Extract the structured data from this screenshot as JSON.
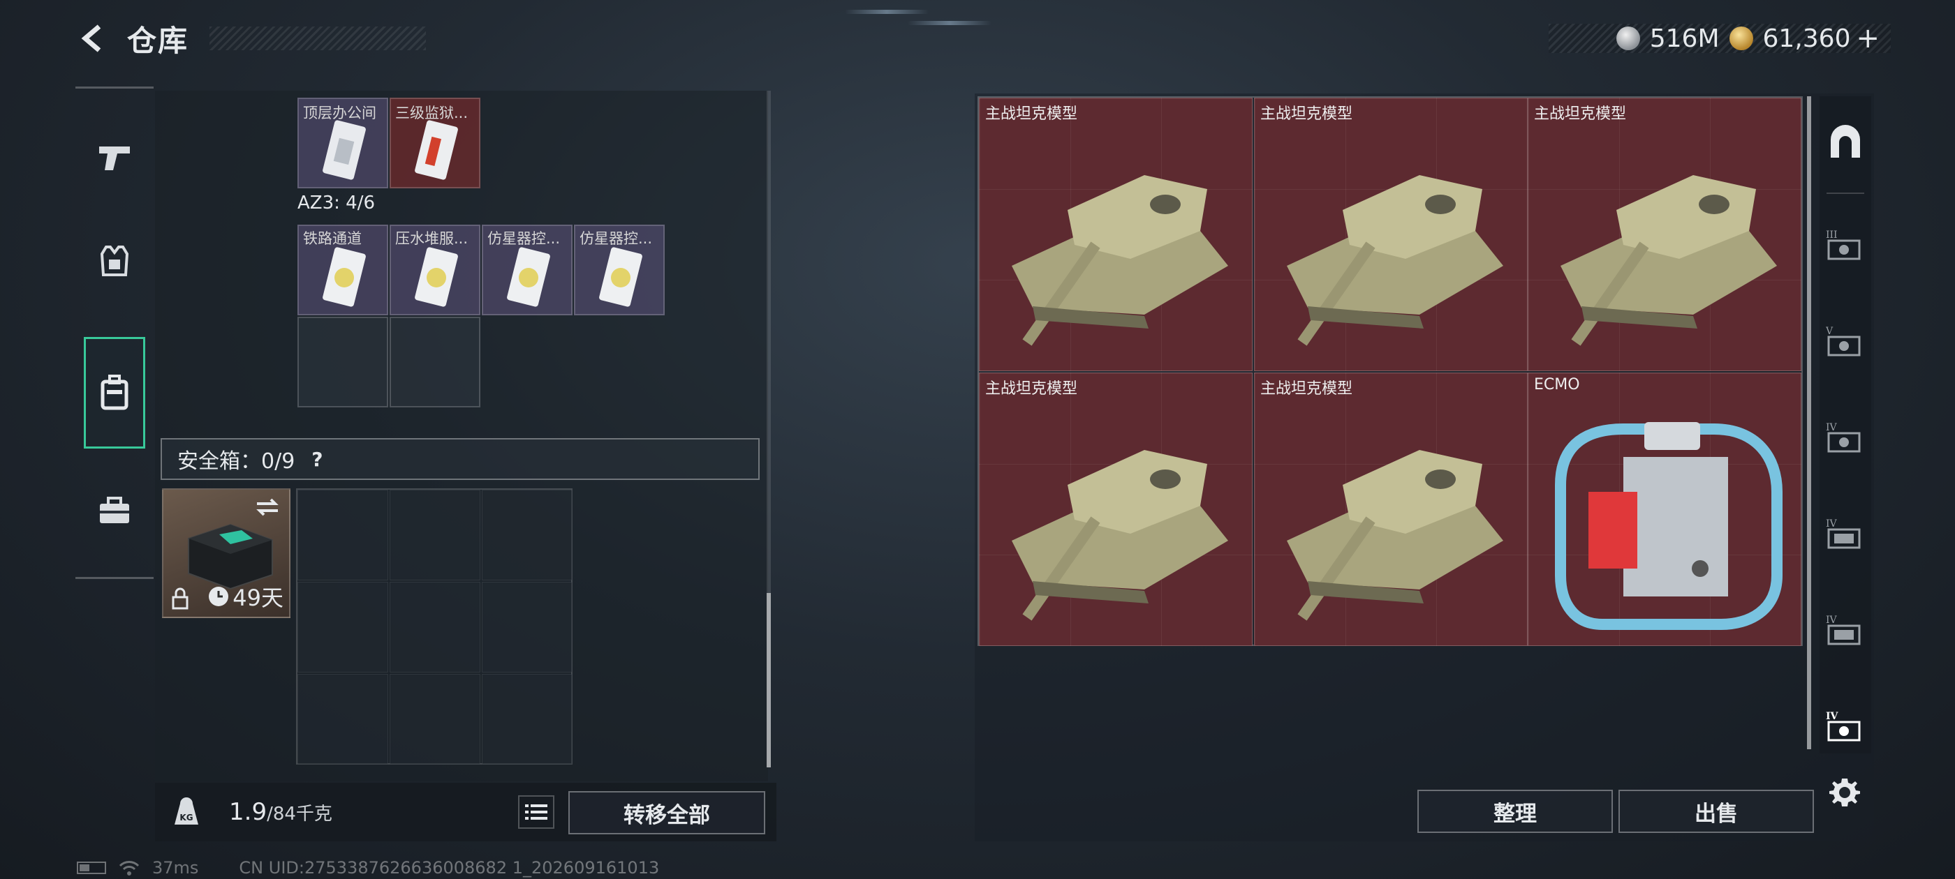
{
  "header": {
    "title": "仓库",
    "currency": [
      {
        "icon": "silver-coin-icon",
        "value": "516M"
      },
      {
        "icon": "gold-coin-icon",
        "value": "61,360"
      }
    ],
    "add_label": "+"
  },
  "left_rail": {
    "items": [
      {
        "icon": "pistol-icon",
        "active": false
      },
      {
        "icon": "armor-vest-icon",
        "active": false
      },
      {
        "icon": "backpack-icon",
        "active": true
      },
      {
        "icon": "toolbox-icon",
        "active": false
      }
    ]
  },
  "inventory": {
    "top_cards": [
      {
        "label": "顶层办公间",
        "color": "purple"
      },
      {
        "label": "三级监狱...",
        "color": "red"
      }
    ],
    "zone_label": "AZ3: 4/6",
    "zone_cards": [
      {
        "label": "铁路通道"
      },
      {
        "label": "压水堆服..."
      },
      {
        "label": "仿星器控..."
      },
      {
        "label": "仿星器控..."
      }
    ]
  },
  "safebox": {
    "label": "安全箱：0/9",
    "help": "?",
    "timer": "49天"
  },
  "bottom_bar": {
    "weight_current": "1.9",
    "weight_max": "/84千克",
    "transfer_all": "转移全部"
  },
  "stash": {
    "items": [
      {
        "label": "主战坦克模型",
        "type": "tank"
      },
      {
        "label": "主战坦克模型",
        "type": "tank"
      },
      {
        "label": "主战坦克模型",
        "type": "tank"
      },
      {
        "label": "主战坦克模型",
        "type": "tank"
      },
      {
        "label": "主战坦克模型",
        "type": "tank"
      },
      {
        "label": "ECMO",
        "type": "ecmo"
      }
    ],
    "sort": "整理",
    "sell": "出售"
  },
  "right_rail": {
    "icons": [
      "arch-icon",
      "tier-iii-stash-icon",
      "tier-v-stash-icon",
      "tier-iv-stash-icon",
      "tier-iv-stash-icon",
      "tier-iv-stash-icon",
      "tier-iv-stash-icon",
      "settings-icon"
    ]
  },
  "status": {
    "ping": "37ms",
    "uid": "CN UID:2753387626636008682 1_202609161013"
  },
  "colors": {
    "accent_green": "#38c99a",
    "legendary_red": "#5d2a30"
  }
}
